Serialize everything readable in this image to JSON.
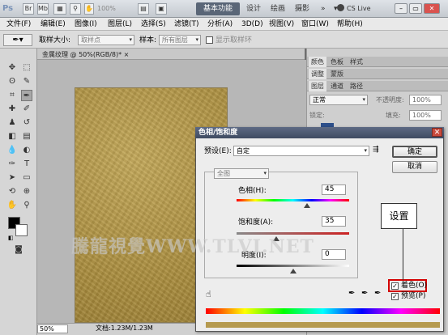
{
  "titlebar": {
    "logo": "Ps",
    "zoom": "100%",
    "workspaces": [
      "基本功能",
      "设计",
      "绘画",
      "摄影"
    ],
    "cs_live": "CS Live"
  },
  "menu": [
    "文件(F)",
    "编辑(E)",
    "图像(I)",
    "图层(L)",
    "选择(S)",
    "滤镜(T)",
    "分析(A)",
    "3D(D)",
    "视图(V)",
    "窗口(W)",
    "帮助(H)"
  ],
  "options": {
    "sample_size_label": "取样大小:",
    "sample_size_value": "取样点",
    "sample_label": "样本:",
    "sample_value": "所有图层",
    "show_ring": "显示取样环"
  },
  "document": {
    "tab_title": "金属纹理 @ 50%(RGB/8)",
    "tab_modified": "*",
    "zoom": "50%",
    "doc_info": "文档:1.23M/1.23M"
  },
  "watermark": "騰龍視覺WWW.TLVI.NET",
  "panels": {
    "tabs_1": [
      "颜色",
      "色板",
      "样式"
    ],
    "tabs_2": [
      "调整",
      "蒙版"
    ],
    "tabs_3": [
      "图层",
      "通道",
      "路径"
    ],
    "blend_mode": "正常",
    "opacity_label": "不透明度:",
    "opacity_value": "100%",
    "lock_label": "锁定:",
    "fill_label": "填充:",
    "fill_value": "100%"
  },
  "dialog": {
    "title": "色相/饱和度",
    "preset_label": "预设(E):",
    "preset_value": "自定",
    "ok": "确定",
    "cancel": "取消",
    "channel": "全图",
    "hue_label": "色相(H):",
    "hue_value": "45",
    "saturation_label": "饱和度(A):",
    "saturation_value": "35",
    "lightness_label": "明度(I):",
    "lightness_value": "0",
    "colorize_label": "着色(O)",
    "colorize_checked": true,
    "preview_label": "预览(P)",
    "preview_checked": true,
    "hue_fraction": 0.625,
    "saturation_fraction": 0.35,
    "lightness_fraction": 0.5
  },
  "callout": "设置",
  "colors": {
    "foreground": "#000000",
    "background": "#ffffff",
    "highlight": "#d40000"
  }
}
